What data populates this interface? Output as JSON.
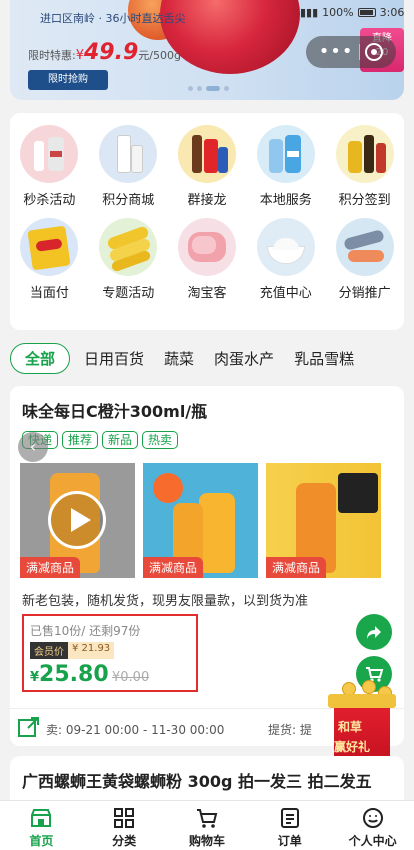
{
  "status": {
    "battery": "100%",
    "time": "3:06"
  },
  "banner": {
    "top_text": "进口区南岭 · 36小时直达舌尖",
    "price_prefix": "限时特惠:",
    "price_symbol": "¥",
    "price_value": "49.9",
    "price_unit": "元/500g",
    "button": "限时抢购",
    "live_tag": "直降",
    "live_sub": "20",
    "slides_count": 4,
    "active_slide": 2
  },
  "menu": {
    "more": "•••",
    "close": "close"
  },
  "categories": [
    {
      "label": "秒杀活动",
      "icon": "cosmetics-icon"
    },
    {
      "label": "积分商城",
      "icon": "skincare-bottle-icon"
    },
    {
      "label": "群接龙",
      "icon": "drinks-icon"
    },
    {
      "label": "本地服务",
      "icon": "water-bottles-icon"
    },
    {
      "label": "积分签到",
      "icon": "oil-bottles-icon"
    },
    {
      "label": "当面付",
      "icon": "chips-icon"
    },
    {
      "label": "专题活动",
      "icon": "corn-icon"
    },
    {
      "label": "淘宝客",
      "icon": "ham-icon"
    },
    {
      "label": "充值中心",
      "icon": "yogurt-icon"
    },
    {
      "label": "分销推广",
      "icon": "fish-icon"
    }
  ],
  "tabs": [
    "全部",
    "日用百货",
    "蔬菜",
    "肉蛋水产",
    "乳品雪糕"
  ],
  "product": {
    "title": "味全每日C橙汁300ml/瓶",
    "badges": [
      "快递",
      "推荐",
      "新品",
      "热卖"
    ],
    "promo_tag": "满减商品",
    "description": "新老包装，随机发货，现男友限量款，以到货为准",
    "sold_text": "已售10份/ 还剩97份",
    "member_label": "会员价",
    "member_price": "¥ 21.93",
    "price_symbol": "¥",
    "price": "25.80",
    "old_price": "¥0.00",
    "sale_label": "卖: 09-21 00:00 - 11-30 00:00",
    "pickup_label": "提货: 提"
  },
  "gift": {
    "line1": "和草",
    "line2": "赢好礼"
  },
  "next_product": {
    "title": "广西螺蛳王黄袋螺蛳粉 300g 拍一发三 拍二发五"
  },
  "bottom_nav": [
    {
      "label": "首页",
      "icon": "store-icon",
      "active": true
    },
    {
      "label": "分类",
      "icon": "grid-icon",
      "active": false
    },
    {
      "label": "购物车",
      "icon": "cart-icon",
      "active": false
    },
    {
      "label": "订单",
      "icon": "order-list-icon",
      "active": false
    },
    {
      "label": "个人中心",
      "icon": "smile-face-icon",
      "active": false
    }
  ],
  "colors": {
    "accent": "#17a24b",
    "promo": "#e74a3b",
    "highlight_border": "#e22d2d"
  }
}
